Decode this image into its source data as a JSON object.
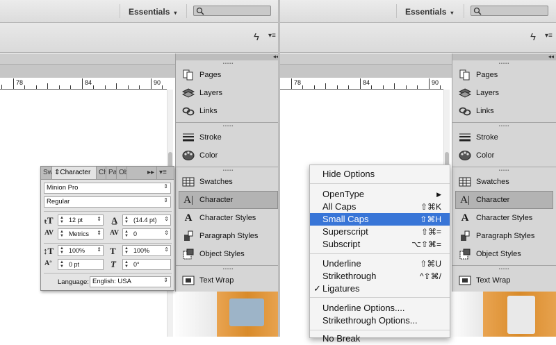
{
  "header": {
    "workspace_label": "Essentials",
    "workspace_caret": "▾"
  },
  "ruler": {
    "labels": [
      "78",
      "84",
      "90"
    ]
  },
  "dock": {
    "collapse_glyph": "◂◂",
    "items": {
      "pages": "Pages",
      "layers": "Layers",
      "links": "Links",
      "stroke": "Stroke",
      "color": "Color",
      "swatches": "Swatches",
      "character": "Character",
      "character_styles": "Character Styles",
      "paragraph_styles": "Paragraph Styles",
      "object_styles": "Object Styles",
      "text_wrap": "Text Wrap"
    }
  },
  "character_panel": {
    "tabs": [
      "Sw",
      "Character",
      "Ch",
      "Pa",
      "Ob"
    ],
    "tab_arrows": "▸▸",
    "font_family": "Minion Pro",
    "font_style": "Regular",
    "font_size": "12 pt",
    "leading": "(14.4 pt)",
    "kerning": "Metrics",
    "tracking": "0",
    "vertical_scale": "100%",
    "horizontal_scale": "100%",
    "baseline_shift": "0 pt",
    "skew": "0°",
    "language_label": "Language:",
    "language_value": "English: USA"
  },
  "context_menu": {
    "hide_options": "Hide Options",
    "opentype": "OpenType",
    "opentype_arrow": "▶",
    "all_caps": "All Caps",
    "all_caps_sc": "⇧⌘K",
    "small_caps": "Small Caps",
    "small_caps_sc": "⇧⌘H",
    "superscript": "Superscript",
    "superscript_sc": "⇧⌘=",
    "subscript": "Subscript",
    "subscript_sc": "⌥⇧⌘=",
    "underline": "Underline",
    "underline_sc": "⇧⌘U",
    "strikethrough": "Strikethrough",
    "strikethrough_sc": "^⇧⌘/",
    "ligatures": "Ligatures",
    "ligatures_check": "✓",
    "underline_options": "Underline Options....",
    "strikethrough_options": "Strikethrough Options...",
    "no_break": "No Break"
  },
  "colors": {
    "menu_highlight": "#3875d7",
    "dock_bg": "#d6d6d6"
  }
}
